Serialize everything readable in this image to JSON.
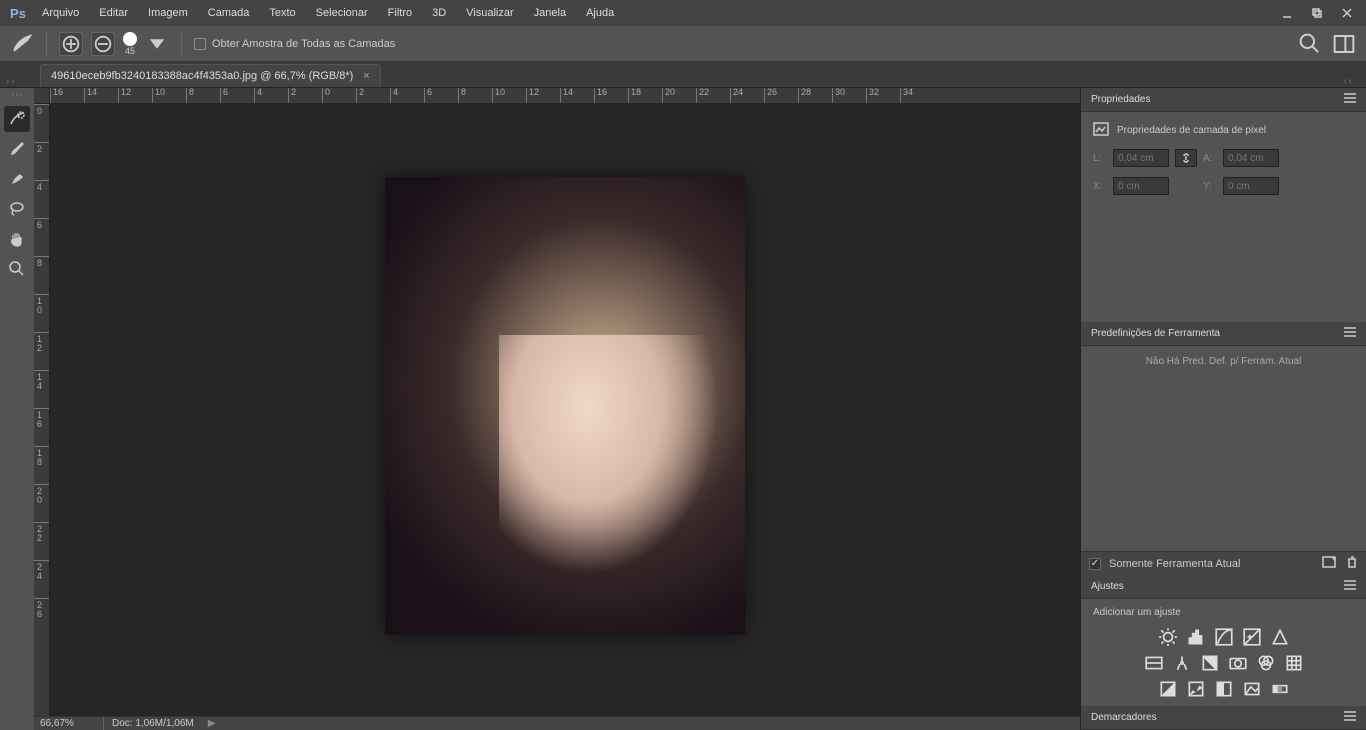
{
  "app": {
    "logo": "Ps"
  },
  "menu": [
    "Arquivo",
    "Editar",
    "Imagem",
    "Camada",
    "Texto",
    "Selecionar",
    "Filtro",
    "3D",
    "Visualizar",
    "Janela",
    "Ajuda"
  ],
  "options": {
    "brush_size": "45",
    "sample_all": "Obter Amostra de Todas as Camadas"
  },
  "document": {
    "tab": "49610eceb9fb3240183388ac4f4353a0.jpg @ 66,7%  (RGB/8*)"
  },
  "ruler_h": [
    "16",
    "14",
    "12",
    "10",
    "8",
    "6",
    "4",
    "2",
    "0",
    "2",
    "4",
    "6",
    "8",
    "10",
    "12",
    "14",
    "16",
    "18",
    "20",
    "22",
    "24",
    "26",
    "28",
    "30",
    "32",
    "34"
  ],
  "ruler_v": [
    "0",
    "2",
    "4",
    "6",
    "8",
    "10",
    "12",
    "14",
    "16",
    "18",
    "20",
    "22",
    "24",
    "26"
  ],
  "status": {
    "zoom": "66,67%",
    "doc": "Doc: 1,06M/1,06M"
  },
  "panels": {
    "properties": {
      "title": "Propriedades",
      "subtitle": "Propriedades de camada de pixel",
      "labelL": "L:",
      "valL": "0,04 cm",
      "labelA": "A:",
      "valA": "0,04 cm",
      "labelX": "X:",
      "valX": "0 cm",
      "labelY": "Y:",
      "valY": "0 cm"
    },
    "presets": {
      "title": "Predefinições de Ferramenta",
      "empty": "Não Há Pred. Def. p/ Ferram. Atual",
      "only_current": "Somente Ferramenta Atual"
    },
    "adjustments": {
      "title": "Ajustes",
      "add": "Adicionar um ajuste"
    },
    "paths": {
      "title": "Demarcadores"
    }
  }
}
